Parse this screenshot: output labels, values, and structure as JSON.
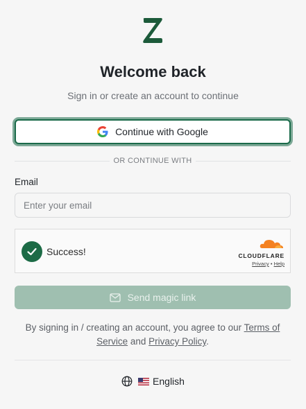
{
  "brand": {
    "logo_letter": "Z",
    "logo_color": "#1c5a3a"
  },
  "header": {
    "title": "Welcome back",
    "subtitle": "Sign in or create an account to continue"
  },
  "google": {
    "label": "Continue with Google",
    "icon": "google-g-icon"
  },
  "divider": {
    "text": "OR CONTINUE WITH"
  },
  "email": {
    "label": "Email",
    "placeholder": "Enter your email",
    "value": ""
  },
  "captcha": {
    "status": "Success!",
    "provider": "CLOUDFLARE",
    "privacy": "Privacy",
    "separator": "•",
    "help": "Help"
  },
  "magic_link": {
    "label": "Send magic link",
    "icon": "mail-icon",
    "enabled": false
  },
  "terms": {
    "prefix": "By signing in / creating an account, you agree to our ",
    "terms_link": "Terms of Service",
    "middle": " and ",
    "privacy_link": "Privacy Policy",
    "suffix": "."
  },
  "language": {
    "flag": "us-flag-icon",
    "label": "English",
    "icon": "globe-icon"
  },
  "colors": {
    "accent": "#1c6b46",
    "accent_disabled": "#9fbfb0",
    "background": "#f6f6f6"
  }
}
